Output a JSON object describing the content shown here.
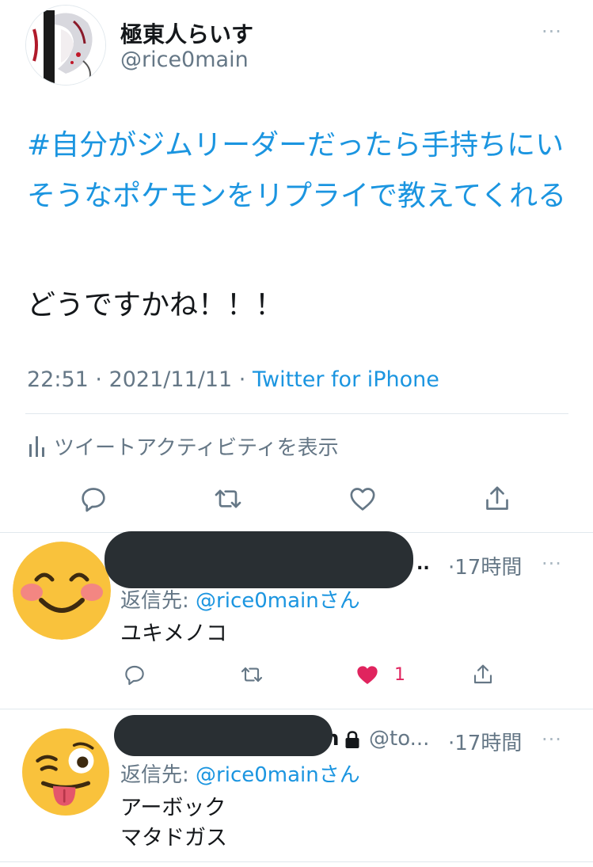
{
  "tweet": {
    "author_name": "極東人らいす",
    "author_handle": "@rice0main",
    "hashtag_text": "#自分がジムリーダーだったら手持ちにいそうなポケモンをリプライで教えてくれる",
    "body_text": "どうですかね！！！",
    "time": "22:51",
    "date": "2021/11/11",
    "source": "Twitter for iPhone",
    "activity_label": "ツイートアクティビティを表示",
    "more_icon": "···"
  },
  "replies": [
    {
      "name_tail": "..",
      "time": "·17時間",
      "reply_prefix": "返信先: ",
      "reply_mention": "@rice0mainさん",
      "lines": [
        "ユキメノコ"
      ],
      "like_count": "1",
      "liked": true,
      "avatar_icon": "blushing-smile-emoji",
      "more_icon": "···"
    },
    {
      "name_tail": "n",
      "handle_partial": "@to...",
      "time": "·17時間",
      "reply_prefix": "返信先: ",
      "reply_mention": "@rice0mainさん",
      "lines": [
        "アーボック",
        "マタドガス"
      ],
      "like_count": "",
      "liked": false,
      "avatar_icon": "winking-tongue-emoji",
      "more_icon": "···"
    }
  ],
  "colors": {
    "accent": "#1b95e0",
    "like": "#e0245e",
    "secondary_text": "#657786",
    "redaction": "#292f33"
  }
}
